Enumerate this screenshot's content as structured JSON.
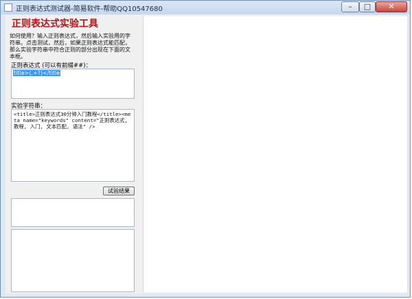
{
  "window": {
    "title": "正则表达式测试器-简易软件-帮助QQ10547680",
    "minimize_glyph": "–",
    "maximize_glyph": "□",
    "close_glyph": "✕"
  },
  "panel": {
    "title": "正则表达式实验工具",
    "description": "如何使用？输入正则表达式，然后输入实验用的字符串。点击测试，然后，如果正则表达式能匹配，那么实验字符串中符合正则的部分出现在下面的文本框。",
    "regex_label": "正则表达式 (可以有前缀##)：",
    "regex_value": "title>(.+?)</title",
    "sample_label": "实验字符串：",
    "sample_value": "<title>正则表达式30分钟入门教程</title><meta name=\"keywords\" content=\"正则表达式, 教程, 入门, 文本匹配, 语法\" />",
    "test_button": "试验结果"
  },
  "icons": {
    "app": "app-icon"
  }
}
